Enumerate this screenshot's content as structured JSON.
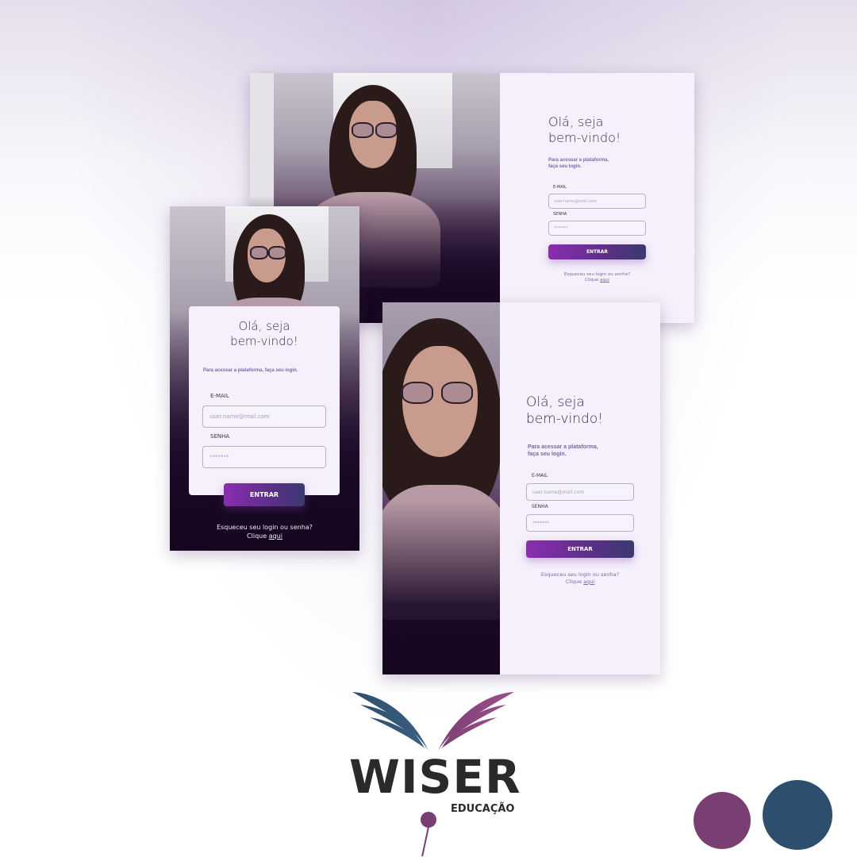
{
  "greeting_line1": "Olá, seja",
  "greeting_line2": "bem-vindo!",
  "subtitle_short": "Para acessar a plataforma,",
  "subtitle_short2": "faça seu login.",
  "subtitle_long": "Para acessar a plataforma, faça seu login.",
  "email_label": "E-MAIL",
  "email_placeholder": "user.name@mail.com",
  "password_label": "SENHA",
  "password_mask": "*******",
  "submit_label": "ENTRAR",
  "forgot_text": "Esqueceu seu login ou senha?",
  "click_text": "Clique",
  "here_link": "aqui",
  "logo": {
    "name": "WISER",
    "sub": "EDUCAÇÃO"
  },
  "colors": {
    "purple": "#7a3f72",
    "blue": "#2d4f6d",
    "accent": "#8a2eb0"
  }
}
